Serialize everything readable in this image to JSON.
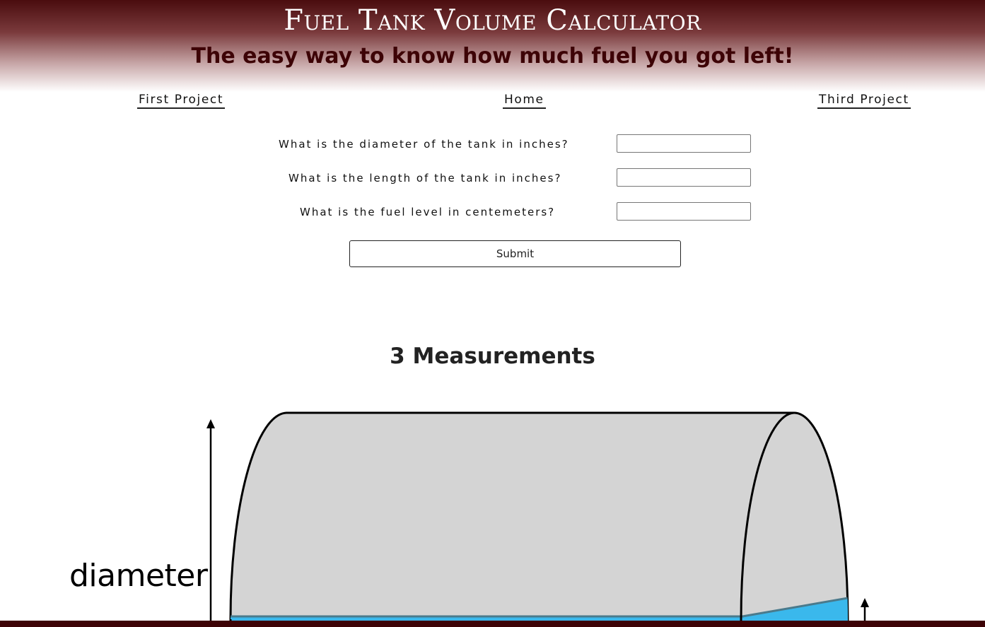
{
  "header": {
    "title": "Fuel Tank Volume Calculator",
    "subtitle": "The easy way to know how much fuel you got left!"
  },
  "nav": {
    "first": "First Project",
    "home": "Home",
    "third": "Third Project"
  },
  "form": {
    "diameter_label": "What is the diameter of the tank in inches?",
    "diameter_value": "",
    "length_label": "What is the length of the tank in inches?",
    "length_value": "",
    "fuel_label": "What is the fuel level in centemeters?",
    "fuel_value": "",
    "submit_label": "Submit"
  },
  "section": {
    "heading": "3 Measurements"
  },
  "diagram": {
    "label": "diameter",
    "tank_color": "#d4d4d4",
    "fuel_color": "#3ab8ec"
  },
  "theme": {
    "brand": "#4a0c0e",
    "subtitle_color": "#3d0306"
  }
}
